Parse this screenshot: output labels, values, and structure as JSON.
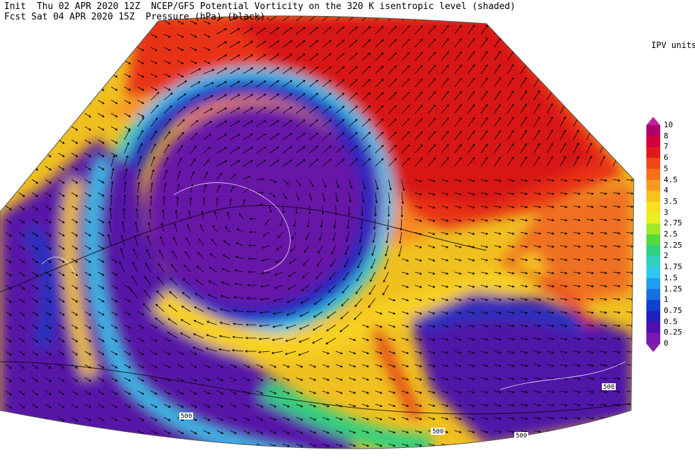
{
  "header": {
    "init_line": "Init  Thu 02 APR 2020 12Z  NCEP/GFS Potential Vorticity on the 320 K isentropic level (shaded)",
    "fcst_line": "Fcst Sat 04 APR 2020 15Z  Pressure (hPa) (black)."
  },
  "colorbar": {
    "title": "IPV units",
    "labels": [
      "10",
      "8",
      "7",
      "6",
      "5",
      "4.5",
      "4",
      "3.5",
      "3",
      "2.75",
      "2.5",
      "2.25",
      "2",
      "1.75",
      "1.5",
      "1.25",
      "1",
      "0.75",
      "0.5",
      "0.25",
      "0"
    ],
    "colors": [
      "#b0006a",
      "#d0003a",
      "#e01a1a",
      "#f04818",
      "#f87018",
      "#f89a20",
      "#f8c020",
      "#f8e020",
      "#e8f020",
      "#a0e828",
      "#58d840",
      "#30d080",
      "#30d0c0",
      "#30c8f0",
      "#20a0f0",
      "#1870e0",
      "#1040d0",
      "#2020c0",
      "#5010b0",
      "#7818b0"
    ],
    "arrow_top_color": "#c020a0",
    "arrow_bottom_color": "#8020a8"
  },
  "map": {
    "contour_labels": [
      "500",
      "500",
      "500",
      "500"
    ]
  }
}
